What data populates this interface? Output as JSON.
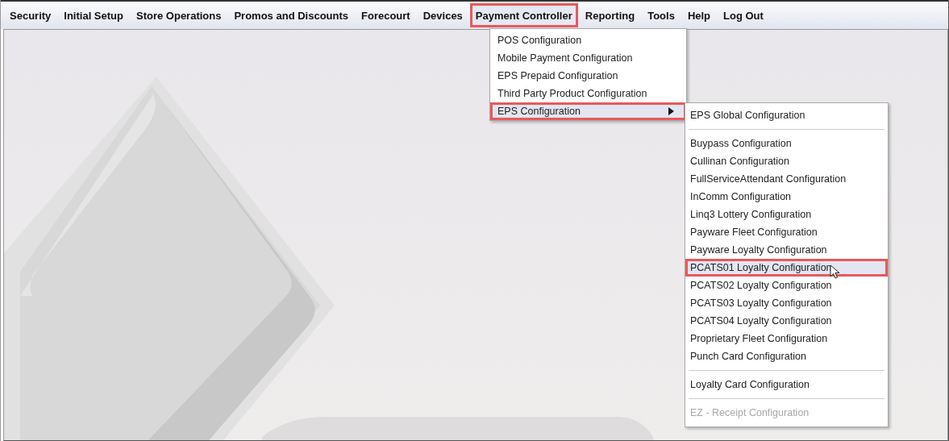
{
  "menubar": [
    {
      "label": "Security",
      "selected": false
    },
    {
      "label": "Initial Setup",
      "selected": false
    },
    {
      "label": "Store Operations",
      "selected": false
    },
    {
      "label": "Promos and Discounts",
      "selected": false
    },
    {
      "label": "Forecourt",
      "selected": false
    },
    {
      "label": "Devices",
      "selected": false
    },
    {
      "label": "Payment Controller",
      "selected": true
    },
    {
      "label": "Reporting",
      "selected": false
    },
    {
      "label": "Tools",
      "selected": false
    },
    {
      "label": "Help",
      "selected": false
    },
    {
      "label": "Log Out",
      "selected": false
    }
  ],
  "dropdown_menu": {
    "items": [
      {
        "label": "POS Configuration",
        "selected": false,
        "submenu": false
      },
      {
        "label": "Mobile Payment Configuration",
        "selected": false,
        "submenu": false
      },
      {
        "label": "EPS Prepaid Configuration",
        "selected": false,
        "submenu": false
      },
      {
        "label": "Third Party Product Configuration",
        "selected": false,
        "submenu": false
      },
      {
        "label": "EPS Configuration",
        "selected": true,
        "submenu": true
      }
    ]
  },
  "submenu": {
    "items": [
      {
        "kind": "item",
        "label": "EPS Global Configuration",
        "selected": false,
        "disabled": false
      },
      {
        "kind": "separator"
      },
      {
        "kind": "item",
        "label": "Buypass Configuration",
        "selected": false,
        "disabled": false
      },
      {
        "kind": "item",
        "label": "Cullinan Configuration",
        "selected": false,
        "disabled": false
      },
      {
        "kind": "item",
        "label": "FullServiceAttendant Configuration",
        "selected": false,
        "disabled": false
      },
      {
        "kind": "item",
        "label": "InComm Configuration",
        "selected": false,
        "disabled": false
      },
      {
        "kind": "item",
        "label": "Linq3 Lottery Configuration",
        "selected": false,
        "disabled": false
      },
      {
        "kind": "item",
        "label": "Payware Fleet Configuration",
        "selected": false,
        "disabled": false
      },
      {
        "kind": "item",
        "label": "Payware Loyalty Configuration",
        "selected": false,
        "disabled": false
      },
      {
        "kind": "item",
        "label": "PCATS01 Loyalty Configuration",
        "selected": true,
        "disabled": false
      },
      {
        "kind": "item",
        "label": "PCATS02 Loyalty Configuration",
        "selected": false,
        "disabled": false
      },
      {
        "kind": "item",
        "label": "PCATS03 Loyalty Configuration",
        "selected": false,
        "disabled": false
      },
      {
        "kind": "item",
        "label": "PCATS04 Loyalty Configuration",
        "selected": false,
        "disabled": false
      },
      {
        "kind": "item",
        "label": "Proprietary Fleet Configuration",
        "selected": false,
        "disabled": false
      },
      {
        "kind": "item",
        "label": "Punch Card Configuration",
        "selected": false,
        "disabled": false
      },
      {
        "kind": "separator"
      },
      {
        "kind": "item",
        "label": "Loyalty Card Configuration",
        "selected": false,
        "disabled": false
      },
      {
        "kind": "separator"
      },
      {
        "kind": "item",
        "label": "EZ - Receipt Configuration",
        "selected": false,
        "disabled": true
      }
    ]
  }
}
